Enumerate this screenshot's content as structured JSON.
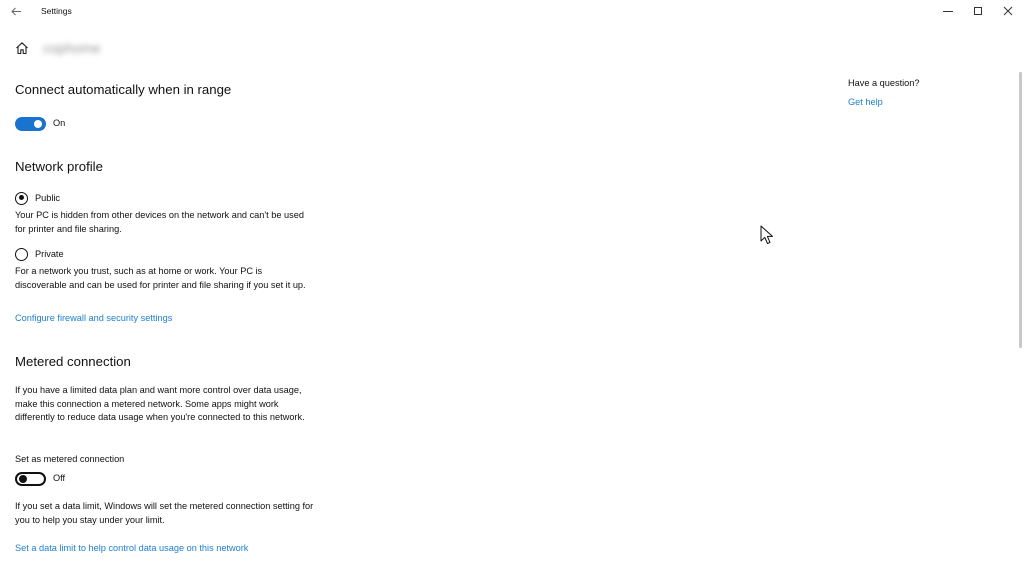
{
  "window": {
    "title": "Settings"
  },
  "header": {
    "network_name": "cophome"
  },
  "auto_connect": {
    "heading": "Connect automatically when in range",
    "toggle_state": "On",
    "enabled": true
  },
  "network_profile": {
    "heading": "Network profile",
    "options": [
      {
        "label": "Public",
        "selected": true,
        "description": "Your PC is hidden from other devices on the network and can't be used for printer and file sharing."
      },
      {
        "label": "Private",
        "selected": false,
        "description": "For a network you trust, such as at home or work. Your PC is discoverable and can be used for printer and file sharing if you set it up."
      }
    ],
    "firewall_link": "Configure firewall and security settings"
  },
  "metered": {
    "heading": "Metered connection",
    "description": "If you have a limited data plan and want more control over data usage, make this connection a metered network. Some apps might work differently to reduce data usage when you're connected to this network.",
    "set_label": "Set as metered connection",
    "toggle_state": "Off",
    "enabled": false,
    "limit_note": "If you set a data limit, Windows will set the metered connection setting for you to help you stay under your limit.",
    "limit_link": "Set a data limit to help control data usage on this network"
  },
  "aside": {
    "question": "Have a question?",
    "help_link": "Get help"
  },
  "colors": {
    "accent": "#1a73cf",
    "link": "#1e7fcf",
    "text": "#111111"
  },
  "icons": [
    "back-arrow-icon",
    "home-icon",
    "minimize-icon",
    "maximize-icon",
    "close-icon",
    "mouse-cursor-icon"
  ]
}
